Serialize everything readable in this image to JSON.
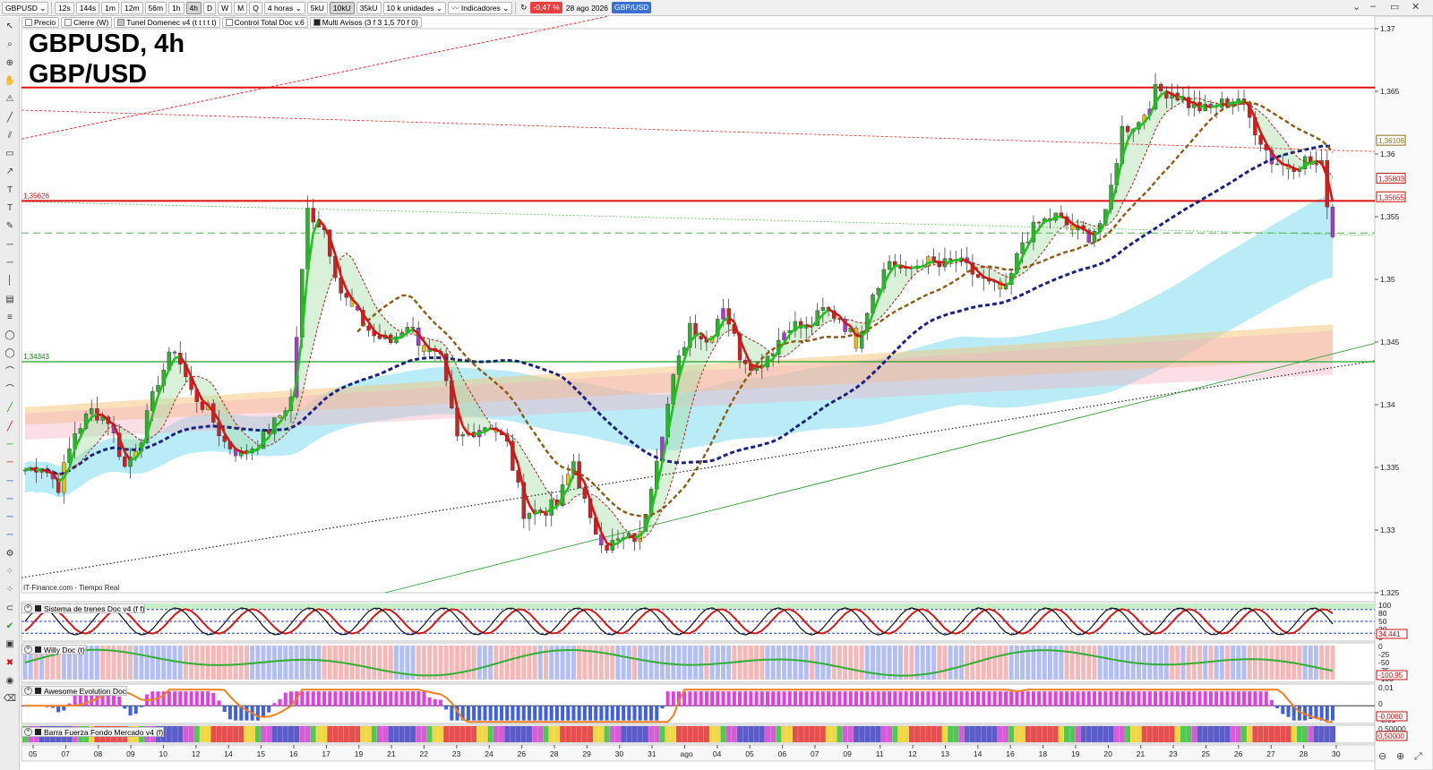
{
  "toolbar": {
    "symbol": "GBPUSD",
    "timeframes": [
      "12s",
      "144s",
      "1m",
      "12m",
      "56m",
      "1h",
      "4h",
      "D",
      "W",
      "M",
      "Q"
    ],
    "active_timeframe": "4h",
    "period_select": "4 horas",
    "volume_options": [
      "5kU",
      "10kU",
      "35kU"
    ],
    "active_volume": "10kU",
    "units_select": "10 k unidades",
    "indicators_label": "Indicadores",
    "change_badge": "-0,47 %",
    "date_label": "28 ago 2026",
    "pair_badge": "GBP/USD"
  },
  "legend_bar": {
    "items": [
      "Precio",
      "Cierre (W)",
      "Tunel Domenec v4 (t t t t t)",
      "Control Total Doc v.6",
      "Multi Avisos (3 f 3 1,5 70 f 0)"
    ]
  },
  "chart_title": {
    "line1": "GBPUSD, 4h",
    "line2": "GBP/USD"
  },
  "credit": "IT-Finance.com - Tiempo Real",
  "price_axis": {
    "ticks": [
      "1,37",
      "1,365",
      "1,36",
      "1,355",
      "1,35",
      "1,345",
      "1,34",
      "1,335",
      "1,33",
      "1,325"
    ],
    "tick_values": [
      1.37,
      1.365,
      1.36,
      1.355,
      1.35,
      1.345,
      1.34,
      1.335,
      1.33,
      1.325
    ],
    "y_range": [
      1.325,
      1.37
    ]
  },
  "price_labels": {
    "left_upper": "1,35626",
    "left_lower": "1,34343",
    "right_boxes": [
      {
        "text": "1,36106",
        "value": 1.36106,
        "color": "#8a6a1a"
      },
      {
        "text": "1,35803",
        "value": 1.35803,
        "color": "#c01010"
      },
      {
        "text": "1,35655",
        "value": 1.35655,
        "color": "#c01010"
      }
    ]
  },
  "levels": {
    "resistance_red": 1.3653,
    "support_red": 1.35626,
    "support_green": 1.34343,
    "dashed_green": 1.3537
  },
  "time_axis": {
    "labels": [
      "05",
      "07",
      "08",
      "09",
      "10",
      "12",
      "14",
      "15",
      "16",
      "17",
      "19",
      "21",
      "22",
      "23",
      "24",
      "26",
      "28",
      "29",
      "30",
      "31",
      "ago",
      "04",
      "05",
      "06",
      "07",
      "09",
      "11",
      "12",
      "13",
      "14",
      "16",
      "18",
      "19",
      "20",
      "21",
      "23",
      "25",
      "26",
      "27",
      "28",
      "30"
    ]
  },
  "panes": [
    {
      "title": "Sistema de trenes Doc v4 (f f)",
      "axis": [
        "100",
        "80",
        "50",
        "20",
        "0"
      ],
      "value_box": "34,441"
    },
    {
      "title": "Willy Doc (t)",
      "axis": [
        "0",
        "-25",
        "-50",
        "-75",
        "-100"
      ],
      "value_box": "-100,95"
    },
    {
      "title": "Awesome Evolution Doc",
      "axis": [
        "0,01",
        "0",
        "-0,01"
      ],
      "value_box": "-0,0060"
    },
    {
      "title": "Barra Fuerza Fondo Mercado v4 (f)",
      "axis": [
        "0,50000"
      ],
      "value_box": "0,50000"
    }
  ],
  "chart_data": {
    "type": "candlestick",
    "ylim": [
      1.325,
      1.37
    ],
    "close_anchors": [
      [
        0,
        1.3348
      ],
      [
        3,
        1.3352
      ],
      [
        6,
        1.3335
      ],
      [
        9,
        1.3378
      ],
      [
        12,
        1.3395
      ],
      [
        15,
        1.3388
      ],
      [
        18,
        1.335
      ],
      [
        21,
        1.3375
      ],
      [
        24,
        1.342
      ],
      [
        27,
        1.3445
      ],
      [
        30,
        1.341
      ],
      [
        33,
        1.3395
      ],
      [
        36,
        1.337
      ],
      [
        39,
        1.336
      ],
      [
        42,
        1.337
      ],
      [
        45,
        1.3385
      ],
      [
        48,
        1.3405
      ],
      [
        51,
        1.3555
      ],
      [
        54,
        1.354
      ],
      [
        57,
        1.349
      ],
      [
        60,
        1.347
      ],
      [
        63,
        1.3455
      ],
      [
        66,
        1.345
      ],
      [
        69,
        1.3465
      ],
      [
        72,
        1.3445
      ],
      [
        75,
        1.3435
      ],
      [
        78,
        1.3372
      ],
      [
        81,
        1.338
      ],
      [
        84,
        1.3385
      ],
      [
        87,
        1.3368
      ],
      [
        90,
        1.3315
      ],
      [
        93,
        1.3315
      ],
      [
        96,
        1.332
      ],
      [
        99,
        1.3355
      ],
      [
        102,
        1.3305
      ],
      [
        105,
        1.3288
      ],
      [
        108,
        1.3292
      ],
      [
        111,
        1.3295
      ],
      [
        114,
        1.336
      ],
      [
        117,
        1.342
      ],
      [
        120,
        1.3465
      ],
      [
        123,
        1.345
      ],
      [
        126,
        1.348
      ],
      [
        129,
        1.344
      ],
      [
        132,
        1.343
      ],
      [
        135,
        1.3445
      ],
      [
        138,
        1.3465
      ],
      [
        141,
        1.346
      ],
      [
        144,
        1.3475
      ],
      [
        147,
        1.347
      ],
      [
        150,
        1.345
      ],
      [
        153,
        1.349
      ],
      [
        156,
        1.3515
      ],
      [
        159,
        1.3505
      ],
      [
        162,
        1.3515
      ],
      [
        165,
        1.351
      ],
      [
        168,
        1.3515
      ],
      [
        171,
        1.3505
      ],
      [
        174,
        1.3495
      ],
      [
        177,
        1.349
      ],
      [
        180,
        1.353
      ],
      [
        183,
        1.3545
      ],
      [
        186,
        1.355
      ],
      [
        189,
        1.354
      ],
      [
        192,
        1.3535
      ],
      [
        195,
        1.355
      ],
      [
        198,
        1.362
      ],
      [
        201,
        1.3625
      ],
      [
        204,
        1.365
      ],
      [
        207,
        1.365
      ],
      [
        210,
        1.364
      ],
      [
        213,
        1.3635
      ],
      [
        216,
        1.364
      ],
      [
        219,
        1.3645
      ],
      [
        222,
        1.362
      ],
      [
        225,
        1.3595
      ],
      [
        228,
        1.359
      ],
      [
        231,
        1.3595
      ],
      [
        234,
        1.359
      ],
      [
        236,
        1.3535
      ]
    ]
  }
}
